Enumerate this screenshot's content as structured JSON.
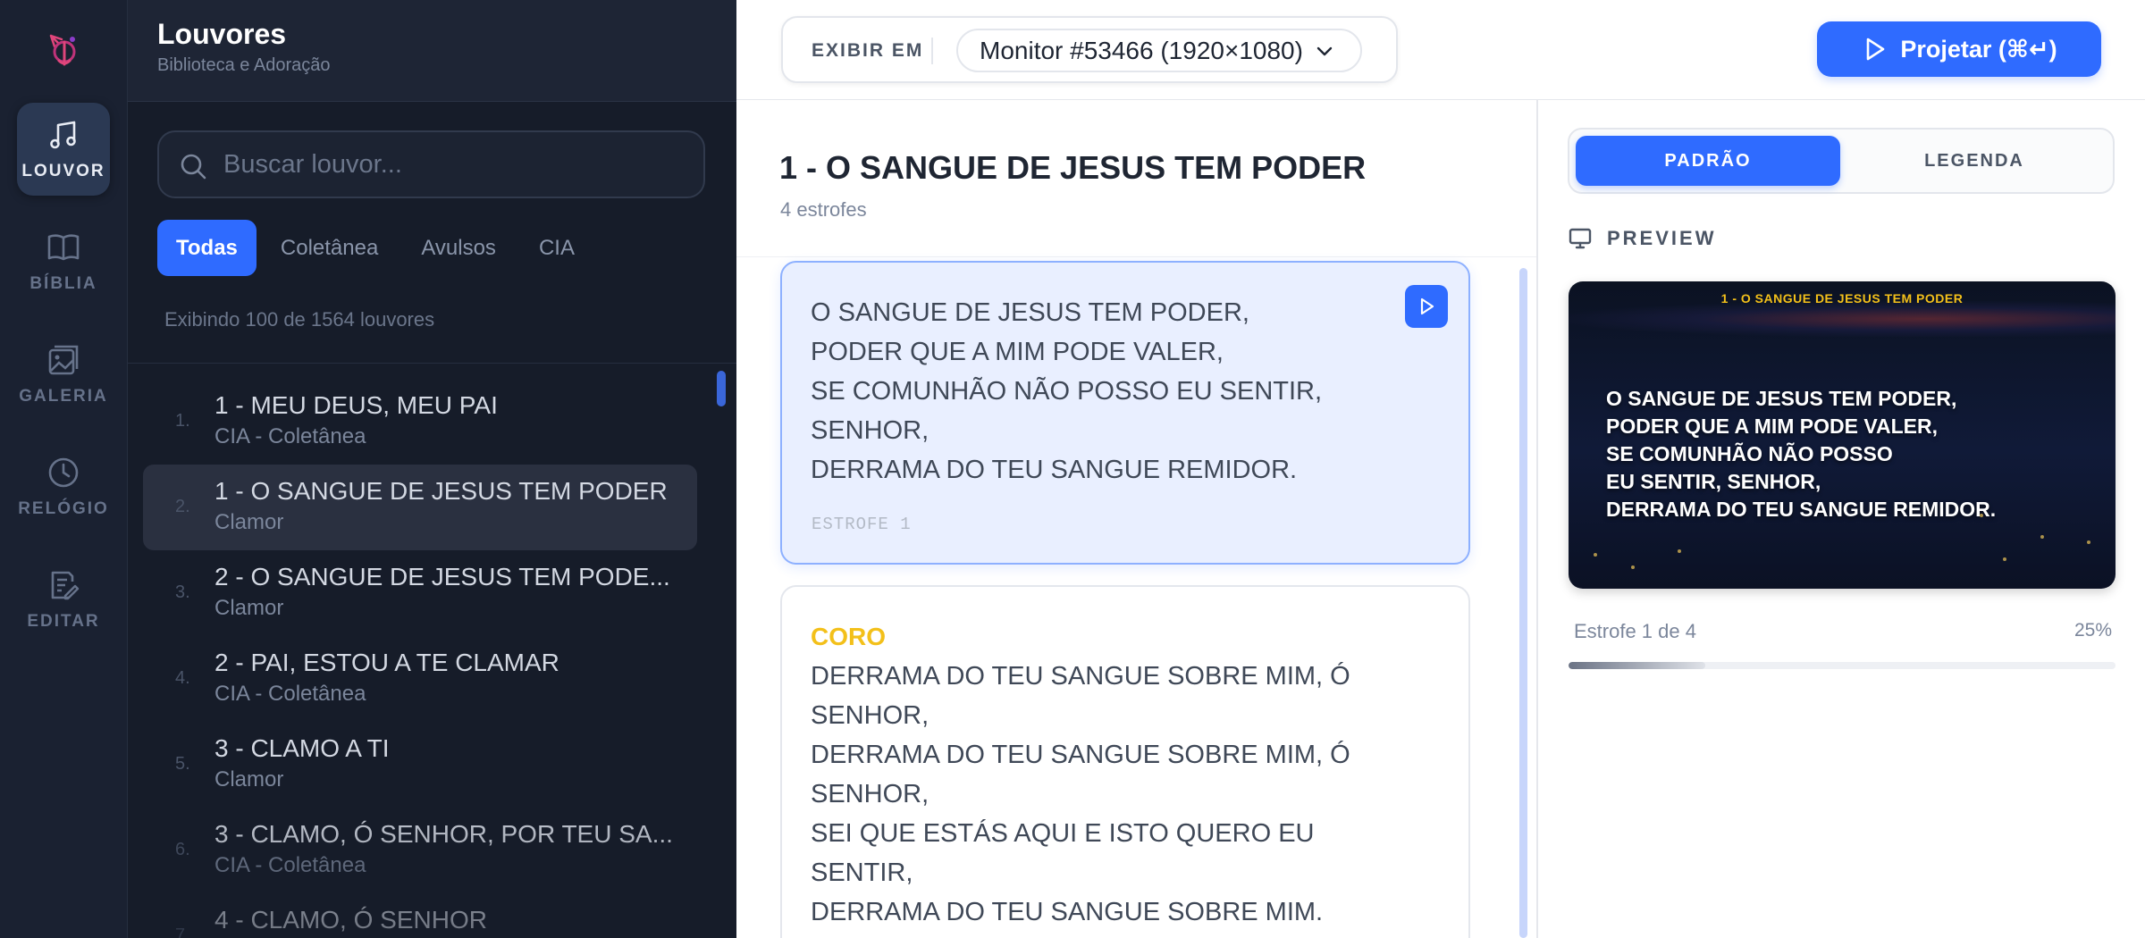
{
  "rail": {
    "items": [
      {
        "label": "LOUVOR",
        "icon": "music-note-icon",
        "active": true
      },
      {
        "label": "BÍBLIA",
        "icon": "book-icon"
      },
      {
        "label": "GALERIA",
        "icon": "image-gallery-icon"
      },
      {
        "label": "RELÓGIO",
        "icon": "clock-icon"
      },
      {
        "label": "EDITAR",
        "icon": "edit-document-icon"
      }
    ]
  },
  "library": {
    "title": "Louvores",
    "subtitle": "Biblioteca e Adoração",
    "search_placeholder": "Buscar louvor...",
    "filters": [
      "Todas",
      "Coletânea",
      "Avulsos",
      "CIA"
    ],
    "active_filter": "Todas",
    "count_text": "Exibindo 100 de 1564 louvores",
    "songs": [
      {
        "num": "1.",
        "title": "1 - MEU DEUS, MEU PAI",
        "source": "CIA - Coletânea"
      },
      {
        "num": "2.",
        "title": "1 - O SANGUE DE JESUS TEM PODER",
        "source": "Clamor",
        "selected": true
      },
      {
        "num": "3.",
        "title": "2 - O SANGUE DE JESUS TEM PODE...",
        "source": "Clamor"
      },
      {
        "num": "4.",
        "title": "2 - PAI, ESTOU A TE CLAMAR",
        "source": "CIA - Coletânea"
      },
      {
        "num": "5.",
        "title": "3 - CLAMO A TI",
        "source": "Clamor"
      },
      {
        "num": "6.",
        "title": "3 - CLAMO, Ó SENHOR, POR TEU SA...",
        "source": "CIA - Coletânea"
      },
      {
        "num": "7.",
        "title": "4 - CLAMO, Ó SENHOR",
        "source": ""
      }
    ]
  },
  "topbar": {
    "display_label": "EXIBIR EM",
    "monitor": "Monitor #53466 (1920×1080)",
    "project_label": "Projetar (⌘↵)"
  },
  "song": {
    "title": "1 - O SANGUE DE JESUS TEM PODER",
    "stanza_count": "4 estrofes",
    "stanzas": [
      {
        "lines": [
          "O SANGUE DE JESUS TEM PODER,",
          "PODER QUE A MIM PODE VALER,",
          "SE COMUNHÃO NÃO POSSO EU SENTIR,",
          "SENHOR,",
          "DERRAMA DO TEU SANGUE REMIDOR."
        ],
        "label": "ESTROFE 1"
      },
      {
        "tag": "CORO",
        "lines": [
          "DERRAMA DO TEU SANGUE SOBRE MIM, Ó",
          "SENHOR,",
          "DERRAMA DO TEU SANGUE SOBRE MIM, Ó",
          "SENHOR,",
          "SEI QUE ESTÁS AQUI E ISTO QUERO EU",
          "SENTIR,",
          "DERRAMA DO TEU SANGUE SOBRE MIM."
        ]
      }
    ]
  },
  "preview": {
    "modes": [
      "PADRÃO",
      "LEGENDA"
    ],
    "active_mode": "PADRÃO",
    "heading": "PREVIEW",
    "slide_title": "1 - O SANGUE DE JESUS TEM PODER",
    "slide_lines": [
      "O SANGUE DE JESUS TEM PODER,",
      "PODER QUE A MIM PODE VALER,",
      "SE COMUNHÃO NÃO POSSO",
      "EU SENTIR, SENHOR,",
      "DERRAMA DO TEU SANGUE REMIDOR."
    ],
    "progress_text": "Estrofe 1 de 4",
    "progress_pct": "25%",
    "progress_value": 0.25
  },
  "colors": {
    "accent": "#2f6bff",
    "rail_bg": "#1a2131",
    "library_bg": "#161c29",
    "chorus_tag": "#f3c01a",
    "slide_title": "#f3c01a"
  }
}
